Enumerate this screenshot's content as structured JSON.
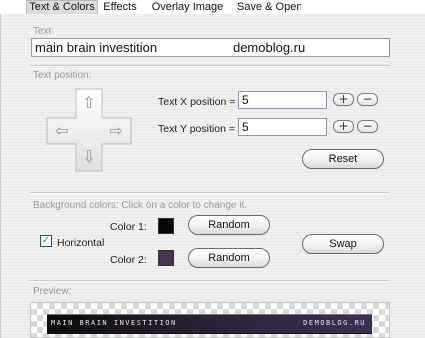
{
  "tabs": [
    {
      "label": "Text & Colors",
      "active": true
    },
    {
      "label": "Effects",
      "active": false
    },
    {
      "label": "Overlay Image",
      "active": false
    },
    {
      "label": "Save & Open",
      "active": false
    }
  ],
  "text_section": {
    "label": "Text:",
    "value": "main brain investition                     demoblog.ru"
  },
  "position_section": {
    "label": "Text position:",
    "x_label": "Text X position =",
    "x_value": "5",
    "y_label": "Text Y position =",
    "y_value": "5",
    "plus_glyph": "+",
    "minus_glyph": "−",
    "reset_label": "Reset",
    "arrows": {
      "up": "⇧",
      "down": "⇩",
      "left": "⇦",
      "right": "⇨"
    }
  },
  "background_section": {
    "label": "Background colors:  Click on a color to change it.",
    "color1_label": "Color 1:",
    "color1": "#0a0507",
    "color2_label": "Color 2:",
    "color2": "#4a3256",
    "random_label": "Random",
    "horizontal_label": "Horizontal",
    "horizontal_checked": true,
    "check_glyph": "✓",
    "swap_label": "Swap"
  },
  "preview_section": {
    "label": "Preview:",
    "banner_left": "MAIN BRAIN INVESTITION",
    "banner_right": "DEMOBLOG.RU"
  }
}
